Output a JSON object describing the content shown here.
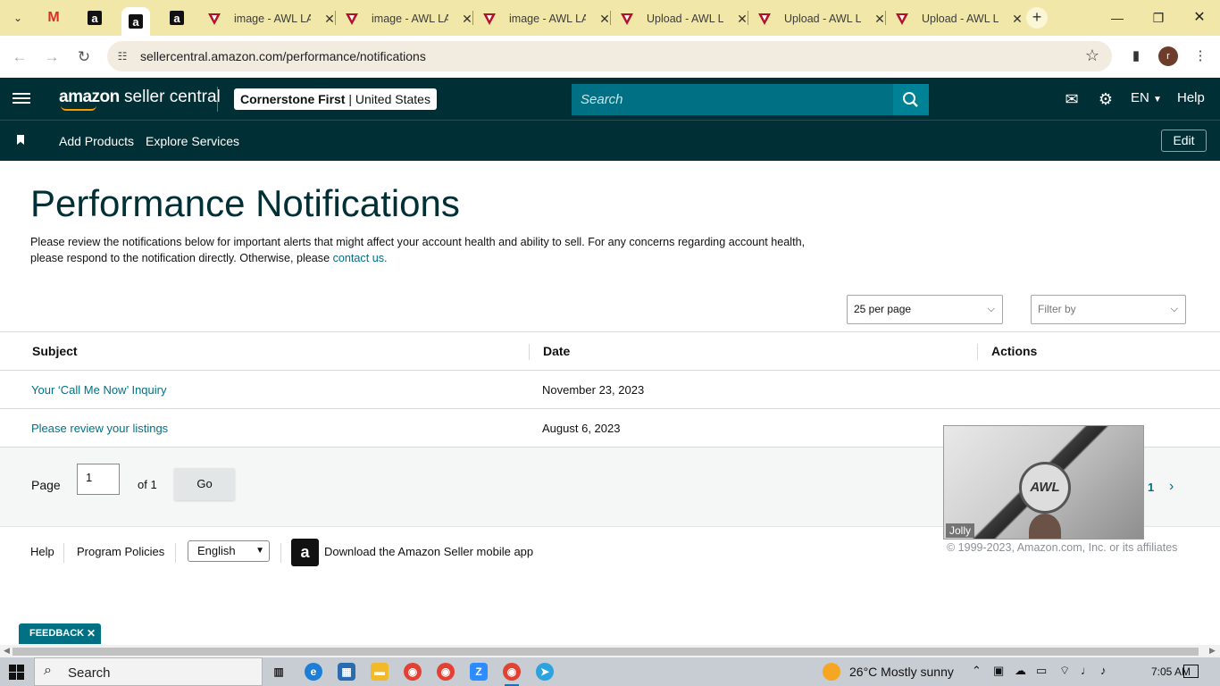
{
  "browser": {
    "pinned_tabs": [
      {
        "name": "gmail",
        "glyph": "M"
      },
      {
        "name": "amazon-1",
        "glyph": "a"
      },
      {
        "name": "amazon-2",
        "glyph": "a"
      },
      {
        "name": "amazon-3",
        "glyph": "a"
      }
    ],
    "tabs": [
      {
        "title": "image - AWL LA"
      },
      {
        "title": "image - AWL LA"
      },
      {
        "title": "image - AWL LA"
      },
      {
        "title": "Upload - AWL L"
      },
      {
        "title": "Upload - AWL L"
      },
      {
        "title": "Upload - AWL L"
      }
    ],
    "url": "sellercentral.amazon.com/performance/notifications",
    "profile_initial": "r"
  },
  "header": {
    "logo_main": "amazon",
    "logo_sub": "seller central",
    "store_name": "Cornerstone First",
    "store_sep": "|",
    "store_region": "United States",
    "search_placeholder": "Search",
    "language": "EN",
    "help": "Help"
  },
  "subnav": {
    "items": [
      "Add Products",
      "Explore Services"
    ],
    "edit": "Edit"
  },
  "main": {
    "title": "Performance Notifications",
    "intro": "Please review the notifications below for important alerts that might affect your account health and ability to sell. For any concerns regarding account health, please respond to the notification directly. Otherwise, please",
    "intro_link": "contact us.",
    "per_page": "25 per page",
    "filter": "Filter by"
  },
  "table": {
    "columns": [
      "Subject",
      "Date",
      "Actions"
    ],
    "rows": [
      {
        "subject": "Your ‘Call Me Now’ Inquiry",
        "date": "November 23, 2023"
      },
      {
        "subject": "Please review your listings",
        "date": "August 6, 2023"
      }
    ]
  },
  "pager": {
    "label": "Page",
    "current": "1",
    "of": "of 1",
    "go": "Go",
    "page_number": "1"
  },
  "footer": {
    "help": "Help",
    "policies": "Program Policies",
    "language": "English",
    "app": "Download the Amazon Seller mobile app",
    "copyright": "© 1999-2023, Amazon.com, Inc. or its affiliates"
  },
  "video_overlay": {
    "caption": "Jolly",
    "logo": "AWL"
  },
  "feedback": "FEEDBACK",
  "taskbar": {
    "search": "Search",
    "weather_temp": "26°C",
    "weather_desc": "Mostly sunny",
    "time": "7:05 AM"
  },
  "colors": {
    "header_bg": "#002f36",
    "link": "#007185",
    "search_bg": "#007185"
  }
}
